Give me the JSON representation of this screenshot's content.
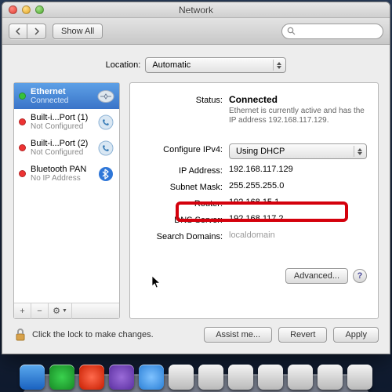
{
  "window": {
    "title": "Network"
  },
  "toolbar": {
    "back_aria": "Back",
    "fwd_aria": "Forward",
    "show_all": "Show All",
    "search_placeholder": ""
  },
  "location": {
    "label": "Location:",
    "value": "Automatic"
  },
  "sidebar": {
    "items": [
      {
        "name": "Ethernet",
        "sub": "Connected",
        "status": "green",
        "icon": "ethernet"
      },
      {
        "name": "Built-i...Port (1)",
        "sub": "Not Configured",
        "status": "red",
        "icon": "phone"
      },
      {
        "name": "Built-i...Port (2)",
        "sub": "Not Configured",
        "status": "red",
        "icon": "phone"
      },
      {
        "name": "Bluetooth PAN",
        "sub": "No IP Address",
        "status": "red",
        "icon": "bluetooth"
      }
    ],
    "footer": {
      "add": "+",
      "remove": "−",
      "action": "⚙"
    }
  },
  "detail": {
    "labels": {
      "status": "Status:",
      "configure": "Configure IPv4:",
      "ip": "IP Address:",
      "subnet": "Subnet Mask:",
      "router": "Router:",
      "dns": "DNS Server:",
      "search_domains": "Search Domains:"
    },
    "status_value": "Connected",
    "status_desc": "Ethernet is currently active and has the IP address 192.168.117.129.",
    "configure_value": "Using DHCP",
    "ip": "192.168.117.129",
    "subnet": "255.255.255.0",
    "router": "192.168.15.1",
    "dns": "192.168.117.2",
    "search_domains": "localdomain",
    "advanced": "Advanced..."
  },
  "footer": {
    "lock_text": "Click the lock to make changes.",
    "assist": "Assist me...",
    "revert": "Revert",
    "apply": "Apply"
  }
}
